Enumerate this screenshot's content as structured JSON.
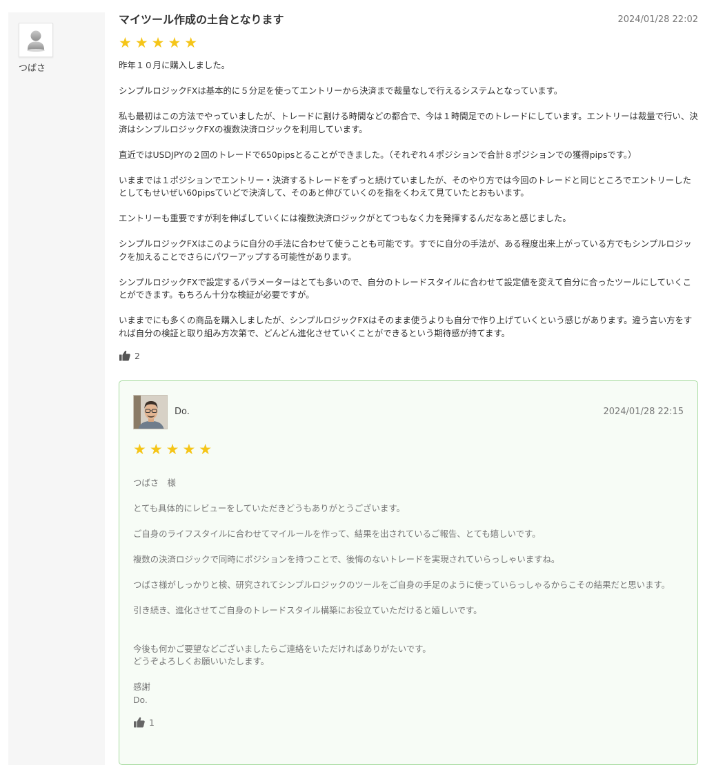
{
  "reviewer": {
    "name": "つばさ",
    "avatar_icon": "default-user-icon"
  },
  "review": {
    "title": "マイツール作成の土台となります",
    "date": "2024/01/28 22:02",
    "rating": 5,
    "stars": "★★★★★",
    "paragraphs": [
      "昨年１０月に購入しました。",
      "シンプルロジックFXは基本的に５分足を使ってエントリーから決済まで裁量なしで行えるシステムとなっています。",
      "私も最初はこの方法でやっていましたが、トレードに割ける時間などの都合で、今は１時間足でのトレードにしています。エントリーは裁量で行い、決済はシンプルロジックFXの複数決済ロジックを利用しています。",
      "直近ではUSDJPYの２回のトレードで650pipsとることができました。（それぞれ４ポジションで合計８ポジションでの獲得pipsです。）",
      "いままでは１ポジションでエントリー・決済するトレードをずっと続けていましたが、そのやり方では今回のトレードと同じところでエントリーしたとしてもせいぜい60pipsていどで決済して、そのあと伸びていくのを指をくわえて見ていたとおもいます。",
      "エントリーも重要ですが利を伸ばしていくには複数決済ロジックがとてつもなく力を発揮するんだなあと感じました。",
      "シンプルロジックFXはこのように自分の手法に合わせて使うことも可能です。すでに自分の手法が、ある程度出来上がっている方でもシンプルロジックを加えることでさらにパワーアップする可能性があります。",
      "シンプルロジックFXで設定するパラメーターはとても多いので、自分のトレードスタイルに合わせて設定値を変えて自分に合ったツールにしていくことができます。もちろん十分な検証が必要ですが。",
      "いままでにも多くの商品を購入しましたが、シンプルロジックFXはそのまま使うよりも自分で作り上げていくという感じがあります。違う言い方をすれば自分の検証と取り組み方次第で、どんどん進化させていくことができるという期待感が持てます。"
    ],
    "likes": "2",
    "like_icon": "thumbs-up-icon"
  },
  "reply": {
    "name": "Do.",
    "date": "2024/01/28 22:15",
    "rating": 5,
    "stars": "★★★★★",
    "avatar_icon": "author-photo",
    "paragraphs": [
      "つばさ　様",
      "とても具体的にレビューをしていただきどうもありがとうございます。",
      "ご自身のライフスタイルに合わせてマイルールを作って、結果を出されているご報告、とても嬉しいです。",
      "複数の決済ロジックで同時にポジションを持つことで、後悔のないトレードを実現されていらっしゃいますね。",
      "つばさ様がしっかりと検、研究されてシンプルロジックのツールをご自身の手足のように使っていらっしゃるからこその結果だと思います。",
      "引き続き、進化させてご自身のトレードスタイル構築にお役立ていただけると嬉しいです。"
    ],
    "closing_line1": "今後も何かご要望などございましたらご連絡をいただければありがたいです。",
    "closing_line2": "どうぞよろしくお願いいたします。",
    "signoff": "感謝",
    "signature": "Do.",
    "likes": "1",
    "like_icon": "thumbs-up-icon"
  },
  "colors": {
    "star": "#f5c518",
    "reply_border": "#a7dba0",
    "reply_background": "#f7fcf6",
    "sidebar_background": "#f6f6f6"
  }
}
